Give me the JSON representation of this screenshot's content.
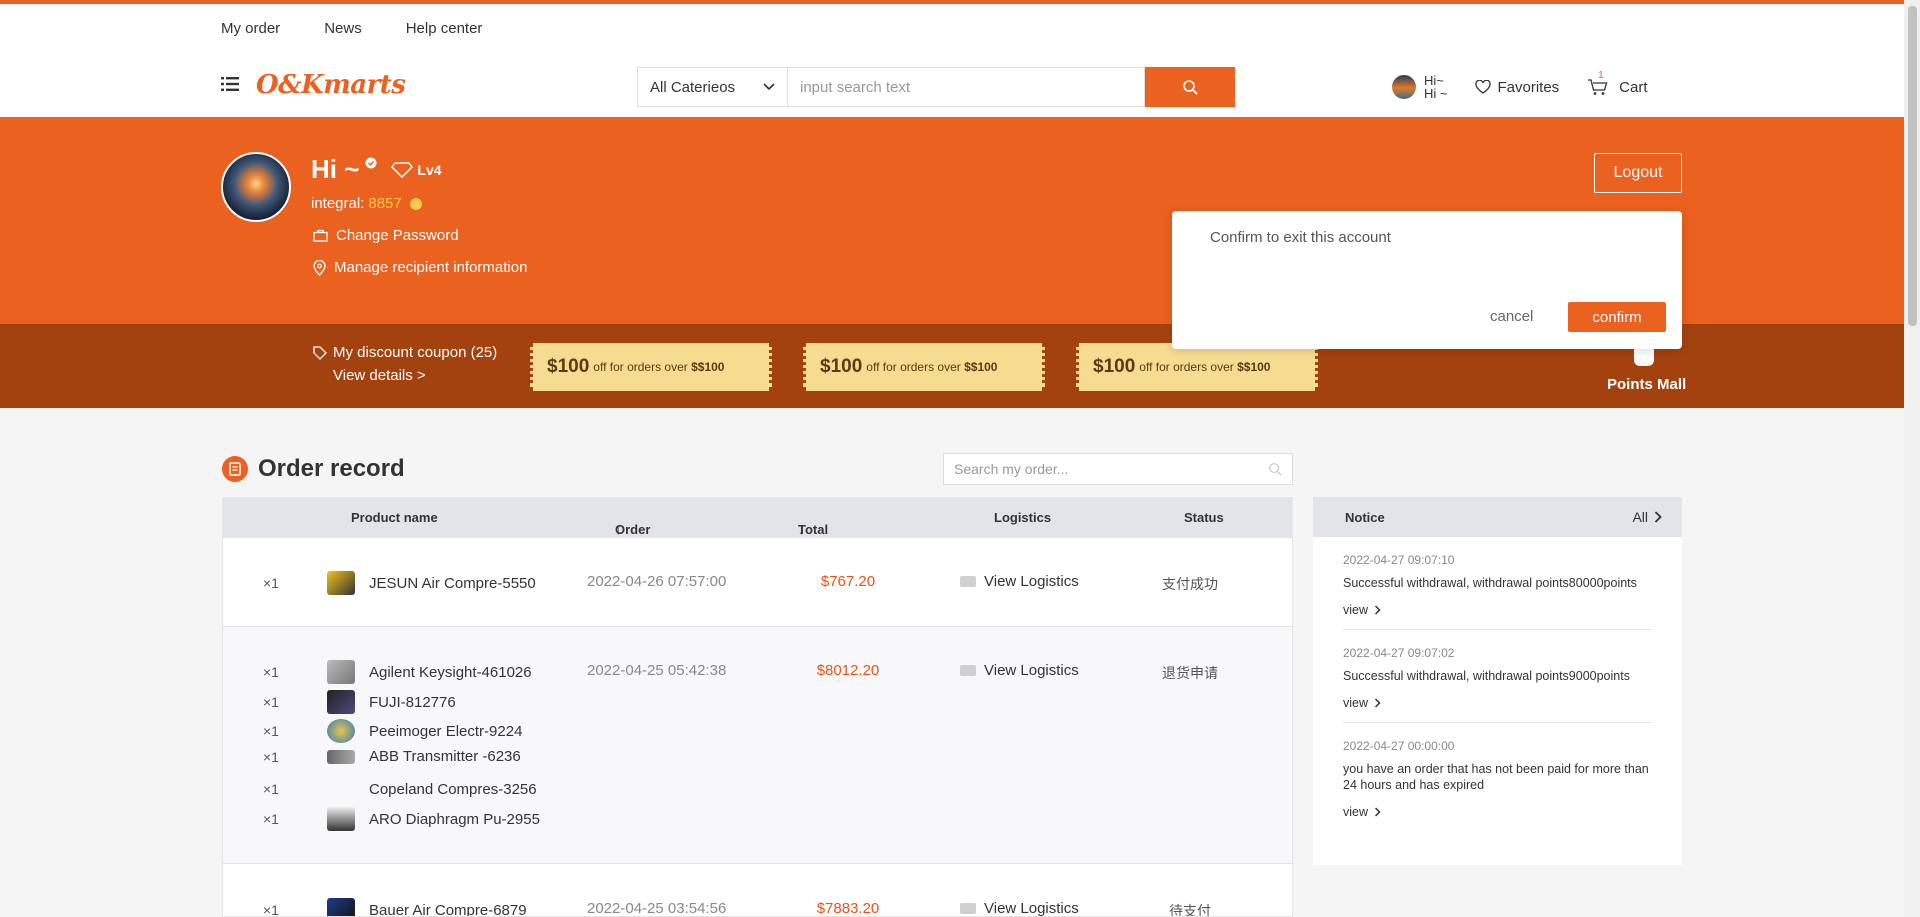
{
  "top_links": [
    "My order",
    "News",
    "Help center"
  ],
  "logo": "O&Kmarts",
  "search": {
    "category": "All Caterieos",
    "placeholder": "input search text"
  },
  "header_right": {
    "hi_line1": "Hi~",
    "hi_line2": "Hi ~",
    "favorites": "Favorites",
    "cart": "Cart",
    "cart_count": "1"
  },
  "profile": {
    "greeting": "Hi ~",
    "vip": "VIP",
    "level": "Lv4",
    "integral_label": "integral:",
    "integral_value": "8857",
    "change_password": "Change Password",
    "manage_recipient": "Manage recipient information",
    "logout": "Logout"
  },
  "dialog": {
    "message": "Confirm to exit this account",
    "cancel": "cancel",
    "confirm": "confirm"
  },
  "coupons": {
    "title": "My discount coupon (25)",
    "view_details": "View details >",
    "items": [
      {
        "amount": "$100",
        "text": "off for orders over ",
        "threshold": "$$100"
      },
      {
        "amount": "$100",
        "text": "off for orders over ",
        "threshold": "$$100"
      },
      {
        "amount": "$100",
        "text": "off for orders over ",
        "threshold": "$$100"
      }
    ],
    "points_mall": "Points Mall"
  },
  "orders": {
    "title": "Order record",
    "search_placeholder": "Search my order...",
    "headers": {
      "product": "Product name",
      "date": "Order date",
      "price": "Total price",
      "logistics": "Logistics",
      "status": "Status"
    },
    "rows": [
      {
        "date": "2022-04-26 07:57:00",
        "price": "$767.20",
        "logistics": "View Logistics",
        "status": "支付成功",
        "items": [
          {
            "qty": "×1",
            "name": "JESUN Air Compre-5550"
          }
        ]
      },
      {
        "date": "2022-04-25 05:42:38",
        "price": "$8012.20",
        "logistics": "View Logistics",
        "status": "退货申请",
        "items": [
          {
            "qty": "×1",
            "name": "Agilent Keysight-461026"
          },
          {
            "qty": "×1",
            "name": "FUJI-812776"
          },
          {
            "qty": "×1",
            "name": "Peeimoger Electr-9224"
          },
          {
            "qty": "×1",
            "name": "ABB Transmitter -6236"
          },
          {
            "qty": "×1",
            "name": "Copeland Compres-3256"
          },
          {
            "qty": "×1",
            "name": "ARO Diaphragm Pu-2955"
          }
        ]
      },
      {
        "date": "2022-04-25 03:54:56",
        "price": "$7883.20",
        "logistics": "View Logistics",
        "status": "待支付",
        "items": [
          {
            "qty": "×1",
            "name": "Bauer Air Compre-6879"
          }
        ]
      }
    ]
  },
  "notice": {
    "title": "Notice",
    "all": "All",
    "items": [
      {
        "date": "2022-04-27 09:07:10",
        "text": "Successful withdrawal, withdrawal points80000points",
        "view": "view"
      },
      {
        "date": "2022-04-27 09:07:02",
        "text": "Successful withdrawal, withdrawal points9000points",
        "view": "view"
      },
      {
        "date": "2022-04-27 00:00:00",
        "text": "you have an order that has not been paid for more than 24 hours and has expired",
        "view": "view"
      }
    ]
  },
  "colors": {
    "accent": "#eb611f",
    "dark_band": "#a4420f",
    "price": "#e8541a",
    "coupon": "#f6dc91"
  }
}
